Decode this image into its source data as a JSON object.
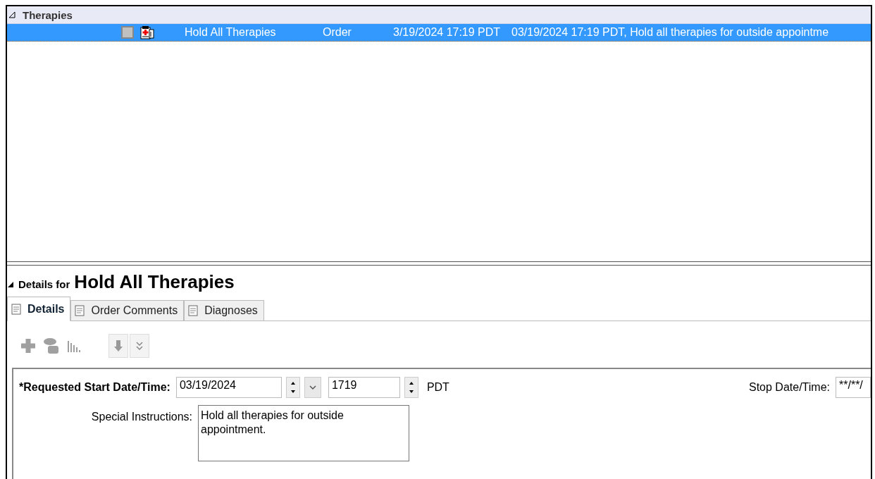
{
  "section": {
    "title": "Therapies",
    "expanded": true
  },
  "rows": [
    {
      "name": "Hold All Therapies",
      "type": "Order",
      "start": "3/19/2024 17:19 PDT",
      "details": "03/19/2024 17:19 PDT, Hold all therapies for outside appointme",
      "selected": true
    }
  ],
  "details": {
    "prefix": "Details for",
    "title": "Hold All Therapies",
    "expanded": true
  },
  "tabs": [
    {
      "label": "Details",
      "selected": true
    },
    {
      "label": "Order Comments",
      "selected": false
    },
    {
      "label": "Diagnoses",
      "selected": false
    }
  ],
  "form": {
    "start_label": "*Requested Start Date/Time:",
    "start_date": "03/19/2024",
    "start_time": "1719",
    "timezone": "PDT",
    "stop_label": "Stop Date/Time:",
    "stop_value": "**/**/",
    "instructions_label": "Special Instructions:",
    "instructions": "Hold all therapies for outside appointment."
  }
}
